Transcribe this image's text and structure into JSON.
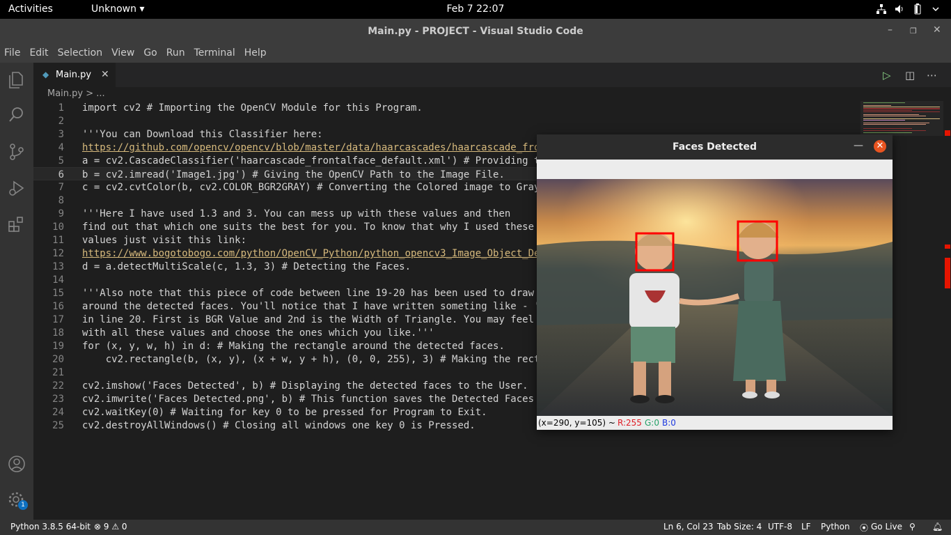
{
  "topbar": {
    "activities": "Activities",
    "app_menu": "Unknown ▾",
    "clock": "Feb 7  22:07"
  },
  "window": {
    "title": "Main.py - PROJECT - Visual Studio Code"
  },
  "menu": [
    "File",
    "Edit",
    "Selection",
    "View",
    "Go",
    "Run",
    "Terminal",
    "Help"
  ],
  "tab": {
    "icon": "python-icon",
    "name": "Main.py"
  },
  "breadcrumb": "Main.py > ...",
  "editor": {
    "active_line": 6,
    "line_numbers": [
      "1",
      "2",
      "3",
      "4",
      "5",
      "6",
      "7",
      "8",
      "9",
      "10",
      "11",
      "12",
      "13",
      "14",
      "15",
      "16",
      "17",
      "18",
      "19",
      "20",
      "21",
      "22",
      "23",
      "24",
      "25"
    ],
    "lines": [
      "import cv2 # Importing the OpenCV Module for this Program.",
      "",
      "'''You can Download this Classifier here:",
      "https://github.com/opencv/opencv/blob/master/data/haarcascades/haarcascade_fro",
      "a = cv2.CascadeClassifier('haarcascade_frontalface_default.xml') # Providing t",
      "b = cv2.imread('Image1.jpg') # Giving the OpenCV Path to the Image File.",
      "c = cv2.cvtColor(b, cv2.COLOR_BGR2GRAY) # Converting the Colored image to Gray",
      "",
      "'''Here I have used 1.3 and 3. You can mess up with these values and then",
      "find out that which one suits the best for you. To know that why I used these",
      "values just visit this link:",
      "https://www.bogotobogo.com/python/OpenCV_Python/python_opencv3_Image_Object_De",
      "d = a.detectMultiScale(c, 1.3, 3) # Detecting the Faces.",
      "",
      "'''Also note that this piece of code between line 19-20 has been used to draw",
      "around the detected faces. You'll notice that I have written someting like - '",
      "in line 20. First is BGR Value and 2nd is the Width of Triangle. You may feel",
      "with all these values and choose the ones which you like.'''",
      "for (x, y, w, h) in d: # Making the rectangle around the detected faces.",
      "    cv2.rectangle(b, (x, y), (x + w, y + h), (0, 0, 255), 3) # Making the rect",
      "",
      "cv2.imshow('Faces Detected', b) # Displaying the detected faces to the User.",
      "cv2.imwrite('Faces Detected.png', b) # This function saves the Detected Faces",
      "cv2.waitKey(0) # Waiting for key 0 to be pressed for Program to Exit.",
      "cv2.destroyAllWindows() # Closing all windows one key 0 is Pressed."
    ]
  },
  "image_window": {
    "title": "Faces Detected",
    "min_glyph": "—",
    "close_glyph": "✕",
    "pixel_coords": "(x=290, y=105) ~",
    "r": "R:255",
    "g": "G:0",
    "b": "B:0",
    "colors": {
      "r": "#e01b24",
      "g": "#26a269",
      "b": "#1c38e0"
    }
  },
  "statusbar": {
    "python": "Python 3.8.5 64-bit",
    "errors": "⊗ 9 ⚠ 0",
    "position": "Ln 6, Col 23",
    "tabsize": "Tab Size: 4",
    "encoding": "UTF-8",
    "eol": "LF",
    "language": "Python",
    "golive": "Go Live",
    "settings_badge": "1"
  },
  "colors": {
    "editor_bg": "#1e1e1e",
    "statusbar_bg": "#333333",
    "accent_orange": "#e95420",
    "box_red": "#ff0000"
  }
}
